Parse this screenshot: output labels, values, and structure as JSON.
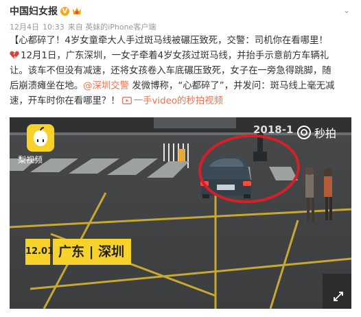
{
  "author": {
    "name": "中国妇女报",
    "verified_icon": "verified-badge-icon",
    "vip_icon": "vip-member-icon"
  },
  "meta": {
    "date": "12月4日",
    "time": "10:33",
    "source": "来自 英妹的iPhone客户端"
  },
  "post": {
    "line1": "【心都碎了！4岁女童牵大人手过斑马线被碾压致死，交警：司机你在看哪里！",
    "line2_after_icon": "12月1日，广东深圳，一女子牵着4岁女孩过斑马线，并抬手示意前方车辆礼",
    "line3": "让。该车不但没有减速，还将女孩卷入车底碾压致死，女子在一旁急得跳脚，随",
    "line4": "后崩溃瘫坐在地。",
    "mention": "@深圳交警",
    "line4_rest": " 发微博称，“心都碎了”，并发问：斑马线上毫无减",
    "line5_prefix": "速，开车时你在看哪里？！",
    "video_link": "一手video的秒拍视频",
    "broken_heart_icon": "broken-heart-icon",
    "video_link_icon": "video-link-icon"
  },
  "video": {
    "app_logo_label": "梨视频",
    "timestamp_overlay": "2018-1",
    "watermark": "秒拍",
    "badge_date": "12.01",
    "badge_location": "广东 | 深圳",
    "fullscreen_icon": "expand-icon"
  },
  "colors": {
    "link": "#eb7350",
    "meta": "#999999",
    "badge": "#f7d22b",
    "circle": "#d4202a"
  }
}
